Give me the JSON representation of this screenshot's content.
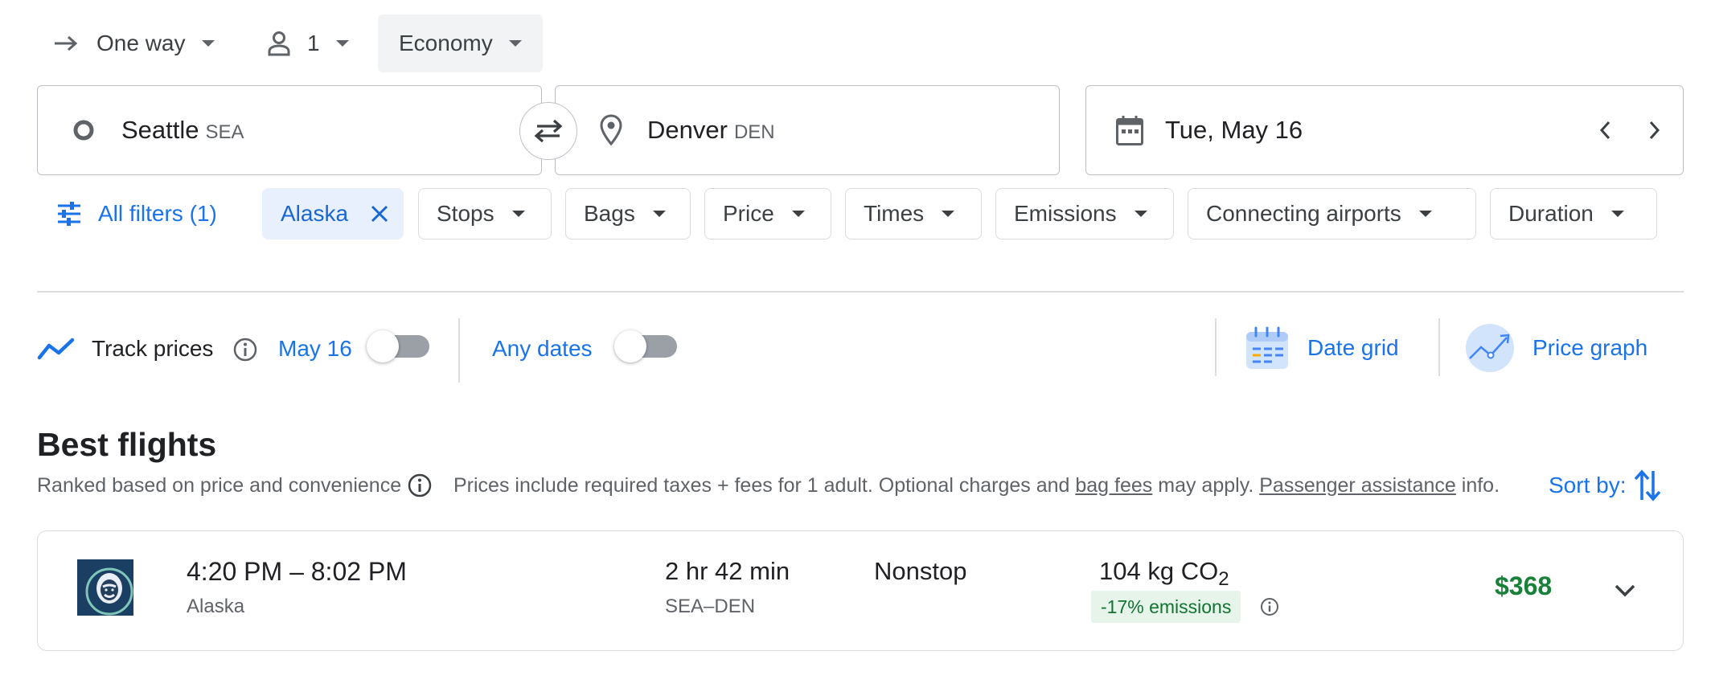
{
  "trip": {
    "type_label": "One way",
    "passengers": "1",
    "cabin": "Economy"
  },
  "route": {
    "origin_city": "Seattle",
    "origin_code": "SEA",
    "destination_city": "Denver",
    "destination_code": "DEN",
    "date": "Tue, May 16"
  },
  "filters": {
    "all_filters": "All filters (1)",
    "active_chip": "Alaska",
    "chips": [
      "Stops",
      "Bags",
      "Price",
      "Times",
      "Emissions",
      "Connecting airports",
      "Duration"
    ]
  },
  "tools": {
    "track_prices": "Track prices",
    "track_date": "May 16",
    "any_dates": "Any dates",
    "date_grid": "Date grid",
    "price_graph": "Price graph"
  },
  "results": {
    "title": "Best flights",
    "ranked_note": "Ranked based on price and convenience",
    "prices_note_prefix": "Prices include required taxes + fees for 1 adult. Optional charges and",
    "bag_fees_link": "bag fees",
    "prices_note_middle": "may apply.",
    "passenger_assistance_link": "Passenger assistance",
    "prices_note_suffix": "info.",
    "sort_label": "Sort by:"
  },
  "flight": {
    "times": "4:20 PM – 8:02 PM",
    "airline": "Alaska",
    "duration": "2 hr 42 min",
    "route": "SEA–DEN",
    "stops": "Nonstop",
    "emissions_value": "104 kg CO",
    "emissions_sub": "2",
    "emissions_badge": "-17% emissions",
    "price": "$368"
  },
  "colors": {
    "accent_blue": "#1a73e8",
    "price_green": "#188038",
    "emissions_badge_bg": "#e6f4ea",
    "chip_active_bg": "#e8f0fe"
  }
}
